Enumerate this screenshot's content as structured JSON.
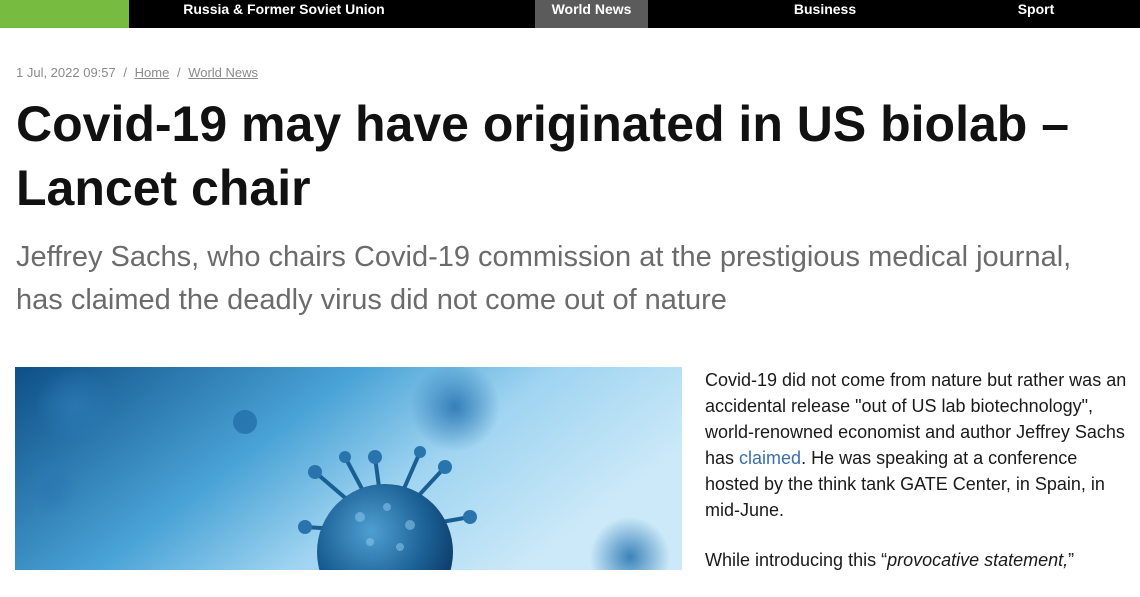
{
  "nav": {
    "items": [
      {
        "label": "Russia & Former Soviet Union",
        "active": false
      },
      {
        "label": "World News",
        "active": true
      },
      {
        "label": "Business",
        "active": false
      },
      {
        "label": "Sport",
        "active": false
      }
    ],
    "accent_color": "#77bb41"
  },
  "breadcrumb": {
    "date": "1 Jul, 2022 09:57",
    "home": "Home",
    "section": "World News"
  },
  "article": {
    "title": "Covid-19 may have originated in US biolab – Lancet chair",
    "summary": "Jeffrey Sachs, who chairs Covid-19 commission at the prestigious medical journal, has claimed the deadly virus did not come out of nature",
    "hero_image": "virus-illustration",
    "para1_before": "Covid-19 did not come from nature but rather was an accidental release \"out of US lab biotechnology\", world-renowned economist and author Jeffrey Sachs has ",
    "para1_link": "claimed",
    "para1_after": ". He was speaking at a conference hosted by the think tank GATE Center, in Spain, in mid-June.",
    "para2_before": "While introducing this “",
    "para2_em": "provocative statement,",
    "para2_after": "”",
    "link_color": "#3a6fa8"
  }
}
